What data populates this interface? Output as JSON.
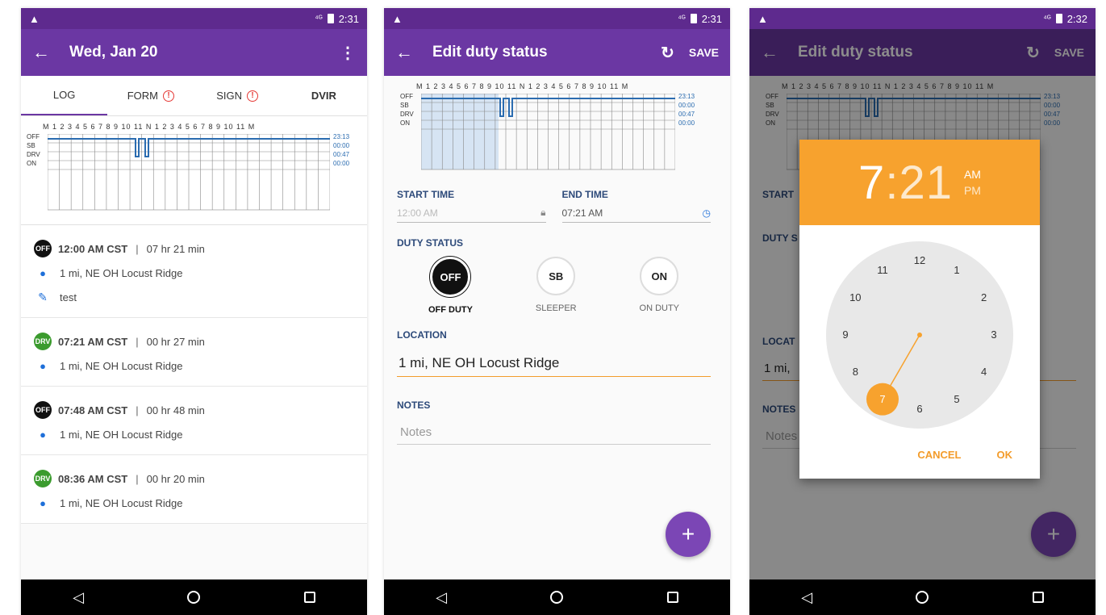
{
  "status_bar": {
    "warning": "▲",
    "signal": "⁴ᴳ",
    "time1": "2:31",
    "time2": "2:31",
    "time3": "2:32"
  },
  "screen1": {
    "title": "Wed, Jan 20",
    "tabs": [
      {
        "label": "LOG"
      },
      {
        "label": "FORM"
      },
      {
        "label": "SIGN"
      },
      {
        "label": "DVIR"
      }
    ],
    "graph": {
      "hours": "M 1 2 3 4 5 6 7 8 9 10 11 N 1 2 3 4 5 6 7 8 9 10 11 M",
      "rows": [
        "OFF",
        "SB",
        "DRV",
        "ON"
      ],
      "totals": [
        "23:13",
        "00:00",
        "00:47",
        "00:00"
      ]
    },
    "entries": [
      {
        "status": "OFF",
        "time": "12:00 AM CST",
        "duration": "07 hr  21 min",
        "location": "1 mi, NE OH Locust Ridge",
        "note": "test"
      },
      {
        "status": "DRV",
        "time": "07:21 AM CST",
        "duration": "00 hr  27 min",
        "location": "1 mi, NE OH Locust Ridge"
      },
      {
        "status": "OFF",
        "time": "07:48 AM CST",
        "duration": "00 hr  48 min",
        "location": "1 mi, NE OH Locust Ridge"
      },
      {
        "status": "DRV",
        "time": "08:36 AM CST",
        "duration": "00 hr  20 min",
        "location": "1 mi, NE OH Locust Ridge"
      }
    ]
  },
  "screen2": {
    "title": "Edit duty status",
    "save": "SAVE",
    "graph": {
      "hours": "M 1 2 3 4 5 6 7 8 9 10 11 N 1 2 3 4 5 6 7 8 9 10 11 M",
      "rows": [
        "OFF",
        "SB",
        "DRV",
        "ON"
      ],
      "totals": [
        "23:13",
        "00:00",
        "00:47",
        "00:00"
      ]
    },
    "start_label": "START TIME",
    "start_value": "12:00 AM",
    "end_label": "END TIME",
    "end_value": "07:21 AM",
    "duty_label": "DUTY STATUS",
    "statuses": [
      {
        "code": "OFF",
        "label": "OFF DUTY"
      },
      {
        "code": "SB",
        "label": "SLEEPER"
      },
      {
        "code": "ON",
        "label": "ON DUTY"
      }
    ],
    "location_label": "LOCATION",
    "location_value": "1 mi, NE OH Locust Ridge",
    "notes_label": "NOTES",
    "notes_placeholder": "Notes"
  },
  "screen3": {
    "title": "Edit duty status",
    "save": "SAVE",
    "start_label": "START",
    "location_label": "LOCAT",
    "location_value": "1 mi,",
    "notes_label": "NOTES",
    "notes_placeholder": "Notes",
    "dialog": {
      "hour": "7",
      "colon": ":",
      "minute": "21",
      "am": "AM",
      "pm": "PM",
      "cancel": "CANCEL",
      "ok": "OK",
      "numbers": [
        "12",
        "1",
        "2",
        "3",
        "4",
        "5",
        "6",
        "7",
        "8",
        "9",
        "10",
        "11"
      ],
      "selected_hour": "7"
    }
  },
  "colors": {
    "appbar": "#6b37a3",
    "statusbar": "#5e2a8e",
    "accent": "#f7a22e",
    "link": "#1e6fd9",
    "fab": "#7b46b5"
  },
  "icons": {
    "back": "arrow-left-icon",
    "menu": "overflow-menu-icon",
    "pin": "location-pin-icon",
    "pencil": "pencil-icon",
    "lock": "lock-icon",
    "clock": "clock-icon",
    "refresh": "refresh-icon",
    "add": "plus-icon"
  }
}
